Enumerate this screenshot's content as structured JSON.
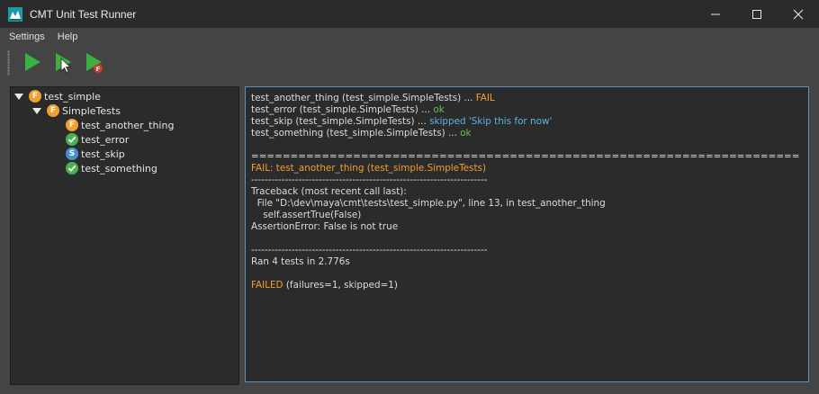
{
  "window": {
    "title": "CMT Unit Test Runner"
  },
  "menu": {
    "settings": "Settings",
    "help": "Help"
  },
  "toolbar": {
    "run_all_icon": "play-icon",
    "run_selected_icon": "play-cursor-icon",
    "run_failed_icon": "play-failed-icon"
  },
  "tree": {
    "items": [
      {
        "label": "test_simple",
        "status": "F",
        "level": 0
      },
      {
        "label": "SimpleTests",
        "status": "F",
        "level": 1
      },
      {
        "label": "test_another_thing",
        "status": "F",
        "level": 2
      },
      {
        "label": "test_error",
        "status": "ok",
        "level": 2
      },
      {
        "label": "test_skip",
        "status": "S",
        "level": 2
      },
      {
        "label": "test_something",
        "status": "ok",
        "level": 2
      }
    ]
  },
  "output": {
    "r1_name": "test_another_thing (test_simple.SimpleTests) ... ",
    "r1_result": "FAIL",
    "r2_name": "test_error (test_simple.SimpleTests) ... ",
    "r2_result": "ok",
    "r3_name": "test_skip (test_simple.SimpleTests) ... ",
    "r3_result": "skipped 'Skip this for now'",
    "r4_name": "test_something (test_simple.SimpleTests) ... ",
    "r4_result": "ok",
    "sep_double": "======================================================================",
    "fail_header": "FAIL: test_another_thing (test_simple.SimpleTests)",
    "sep_single_1": "----------------------------------------------------------------------",
    "tb_1": "Traceback (most recent call last):",
    "tb_2": "  File \"D:\\dev\\maya\\cmt\\tests\\test_simple.py\", line 13, in test_another_thing",
    "tb_3": "    self.assertTrue(False)",
    "tb_4": "AssertionError: False is not true",
    "sep_single_2": "----------------------------------------------------------------------",
    "ran": "Ran 4 tests in 2.776s",
    "final_status": "FAILED",
    "final_detail": " (failures=1, skipped=1)"
  },
  "colors": {
    "fail": "#f0a030",
    "ok": "#6cc04a",
    "skip": "#5ab4e0",
    "play_green": "#3cb043",
    "panel_border_active": "#5a8fc0"
  }
}
